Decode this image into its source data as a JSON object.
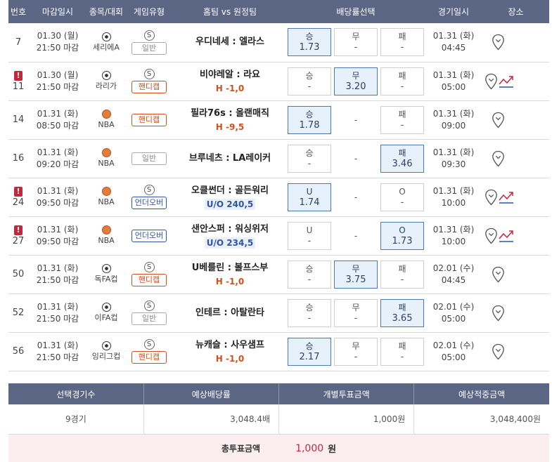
{
  "headers": {
    "num": "번호",
    "deadline": "마감일시",
    "league": "종목/대회",
    "type": "게임유형",
    "match": "홈팀 vs 원정팀",
    "odds": "배당률선택",
    "date": "경기일시",
    "place": "장소"
  },
  "rows": [
    {
      "num": "7",
      "warn": false,
      "dl1": "01.30 (월)",
      "dl2": "21:50 마감",
      "sport": "soccer",
      "league": "세리에A",
      "s": true,
      "type": "일반",
      "typeClass": "general",
      "match": "우디네세 : 엘라스",
      "sub": "",
      "subClass": "",
      "odds": [
        {
          "label": "승",
          "val": "1.73",
          "sel": true,
          "blank": false
        },
        {
          "label": "무",
          "val": "-",
          "sel": false,
          "blank": false
        },
        {
          "label": "패",
          "val": "-",
          "sel": false,
          "blank": false
        }
      ],
      "d1": "01.31 (화)",
      "d2": "04:45",
      "trend": false
    },
    {
      "num": "11",
      "warn": true,
      "dl1": "01.30 (월)",
      "dl2": "21:50 마감",
      "sport": "soccer",
      "league": "라리가",
      "s": true,
      "type": "핸디캡",
      "typeClass": "handicap",
      "match": "비야레알 : 라요",
      "sub": "H -1,0",
      "subClass": "handicap",
      "odds": [
        {
          "label": "승",
          "val": "-",
          "sel": false,
          "blank": false
        },
        {
          "label": "무",
          "val": "3.20",
          "sel": true,
          "blank": false
        },
        {
          "label": "패",
          "val": "-",
          "sel": false,
          "blank": false
        }
      ],
      "d1": "01.31 (화)",
      "d2": "05:00",
      "trend": true
    },
    {
      "num": "14",
      "warn": false,
      "dl1": "01.31 (화)",
      "dl2": "08:50 마감",
      "sport": "basketball",
      "league": "NBA",
      "s": false,
      "type": "핸디캡",
      "typeClass": "handicap",
      "match": "필라76s : 올랜매직",
      "sub": "H -9,5",
      "subClass": "handicap",
      "odds": [
        {
          "label": "승",
          "val": "1.78",
          "sel": true,
          "blank": false
        },
        {
          "label": "-",
          "val": "",
          "sel": false,
          "blank": true
        },
        {
          "label": "패",
          "val": "-",
          "sel": false,
          "blank": false
        }
      ],
      "d1": "01.31 (화)",
      "d2": "09:00",
      "trend": false
    },
    {
      "num": "16",
      "warn": false,
      "dl1": "01.31 (화)",
      "dl2": "09:20 마감",
      "sport": "basketball",
      "league": "NBA",
      "s": false,
      "type": "일반",
      "typeClass": "general",
      "match": "브루네츠 : LA레이커",
      "sub": "",
      "subClass": "",
      "odds": [
        {
          "label": "승",
          "val": "-",
          "sel": false,
          "blank": false
        },
        {
          "label": "-",
          "val": "",
          "sel": false,
          "blank": true
        },
        {
          "label": "패",
          "val": "3.46",
          "sel": true,
          "blank": false
        }
      ],
      "d1": "01.31 (화)",
      "d2": "09:30",
      "trend": false
    },
    {
      "num": "24",
      "warn": true,
      "dl1": "01.31 (화)",
      "dl2": "09:50 마감",
      "sport": "basketball",
      "league": "NBA",
      "s": true,
      "type": "언더오버",
      "typeClass": "overunder",
      "match": "오클썬더 : 골든워리",
      "sub": "U/O 240,5",
      "subClass": "overunder",
      "odds": [
        {
          "label": "U",
          "val": "1.74",
          "sel": true,
          "blank": false
        },
        {
          "label": "-",
          "val": "",
          "sel": false,
          "blank": true
        },
        {
          "label": "O",
          "val": "-",
          "sel": false,
          "blank": false
        }
      ],
      "d1": "01.31 (화)",
      "d2": "10:00",
      "trend": true
    },
    {
      "num": "27",
      "warn": true,
      "dl1": "01.31 (화)",
      "dl2": "09:50 마감",
      "sport": "basketball",
      "league": "NBA",
      "s": false,
      "type": "언더오버",
      "typeClass": "overunder",
      "match": "샌안스퍼 : 워싱위저",
      "sub": "U/O 234,5",
      "subClass": "overunder",
      "odds": [
        {
          "label": "U",
          "val": "-",
          "sel": false,
          "blank": false
        },
        {
          "label": "-",
          "val": "",
          "sel": false,
          "blank": true
        },
        {
          "label": "O",
          "val": "1.73",
          "sel": true,
          "blank": false
        }
      ],
      "d1": "01.31 (화)",
      "d2": "10:00",
      "trend": true
    },
    {
      "num": "50",
      "warn": false,
      "dl1": "01.31 (화)",
      "dl2": "21:50 마감",
      "sport": "soccer",
      "league": "독FA컵",
      "s": true,
      "type": "핸디캡",
      "typeClass": "handicap",
      "match": "U베를린 : 볼프스부",
      "sub": "H -1,0",
      "subClass": "handicap",
      "odds": [
        {
          "label": "승",
          "val": "-",
          "sel": false,
          "blank": false
        },
        {
          "label": "무",
          "val": "3.75",
          "sel": true,
          "blank": false
        },
        {
          "label": "패",
          "val": "-",
          "sel": false,
          "blank": false
        }
      ],
      "d1": "02.01 (수)",
      "d2": "04:45",
      "trend": false
    },
    {
      "num": "52",
      "warn": false,
      "dl1": "01.31 (화)",
      "dl2": "21:50 마감",
      "sport": "soccer",
      "league": "이FA컵",
      "s": true,
      "type": "일반",
      "typeClass": "general",
      "match": "인테르 : 아탈란타",
      "sub": "",
      "subClass": "",
      "odds": [
        {
          "label": "승",
          "val": "-",
          "sel": false,
          "blank": false
        },
        {
          "label": "무",
          "val": "-",
          "sel": false,
          "blank": false
        },
        {
          "label": "패",
          "val": "3.65",
          "sel": true,
          "blank": false
        }
      ],
      "d1": "02.01 (수)",
      "d2": "05:00",
      "trend": false
    },
    {
      "num": "56",
      "warn": false,
      "dl1": "01.31 (화)",
      "dl2": "21:50 마감",
      "sport": "soccer",
      "league": "잉리그컵",
      "s": true,
      "type": "핸디캡",
      "typeClass": "handicap",
      "match": "뉴캐슬 : 사우샘프",
      "sub": "H -1,0",
      "subClass": "handicap",
      "odds": [
        {
          "label": "승",
          "val": "2.17",
          "sel": true,
          "blank": false
        },
        {
          "label": "무",
          "val": "-",
          "sel": false,
          "blank": false
        },
        {
          "label": "패",
          "val": "-",
          "sel": false,
          "blank": false
        }
      ],
      "d1": "02.01 (수)",
      "d2": "05:00",
      "trend": false
    }
  ],
  "summary": {
    "h1": "선택경기수",
    "h2": "예상배당률",
    "h3": "개별투표금액",
    "h4": "예상적중금액",
    "v1": "9경기",
    "v2": "3,048.4배",
    "v3": "1,000원",
    "v4": "3,048,400원"
  },
  "total": {
    "label": "총투표금액",
    "amount": "1,000",
    "unit": "원"
  },
  "colors": {
    "header_bg": "#5b6684",
    "selected_bg": "#e7f1fb",
    "handicap": "#d2501e",
    "overunder": "#2f54a8",
    "warn": "#c0283c"
  }
}
